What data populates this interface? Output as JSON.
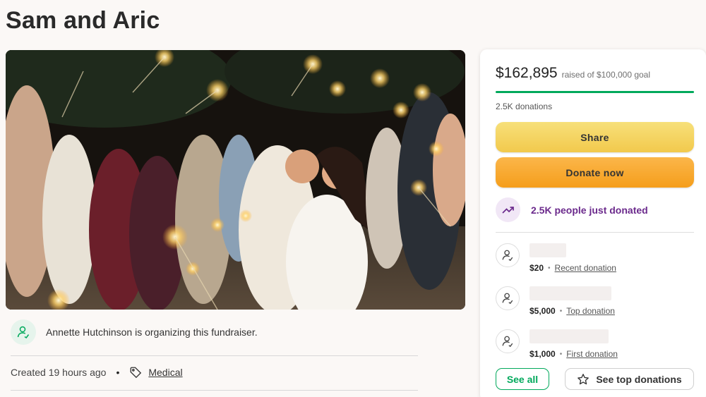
{
  "page": {
    "title": "Sam and Aric"
  },
  "organizer": {
    "text": "Annette Hutchinson is organizing this fundraiser."
  },
  "meta": {
    "created": "Created 19 hours ago",
    "category": "Medical"
  },
  "sidebar": {
    "raised_amount": "$162,895",
    "raised_goal": "raised of $100,000 goal",
    "progress": 1.0,
    "donations_count": "2.5K donations",
    "share_label": "Share",
    "donate_label": "Donate now",
    "momentum_text": "2.5K people just donated",
    "donors": [
      {
        "name": "",
        "amount": "$20",
        "type": "Recent donation"
      },
      {
        "name": "",
        "amount": "$5,000",
        "type": "Top donation"
      },
      {
        "name": "",
        "amount": "$1,000",
        "type": "First donation"
      }
    ],
    "see_all_label": "See all",
    "see_top_label": "See top donations"
  },
  "colors": {
    "accent_green": "#02a95c",
    "share_yellow": "#f2c94c",
    "donate_orange": "#f59e1b",
    "momentum_purple": "#6b2a8c"
  },
  "icons": {
    "organizer": "person-icon",
    "category": "tag-icon",
    "momentum": "trending-up-icon",
    "donor": "person-icon",
    "see_top": "star-icon"
  }
}
